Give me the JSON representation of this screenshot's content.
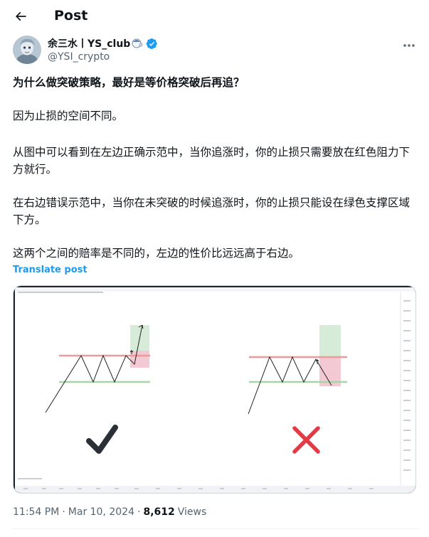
{
  "header": {
    "title": "Post",
    "back_icon": "arrow-left-icon"
  },
  "author": {
    "name": "余三水丨YS_club",
    "handle": "@YSI_crypto",
    "verified": true,
    "verified_color": "#1d9bf0",
    "more_icon": "more-horizontal-icon"
  },
  "tweet": {
    "p1": "为什么做突破策略，最好是等价格突破后再追？",
    "p2": "因为止损的空间不同。",
    "p3": "从图中可以看到在左边正确示范中，当你追涨时，你的止损只需要放在红色阻力下方就行。",
    "p4": "在右边错误示范中，当你在未突破的时候追涨时，你的止损只能设在绿色支撑区域下方。",
    "p5": "这两个之间的赔率是不同的，左边的性价比远远高于右边。",
    "translate_label": "Translate post",
    "translate_color": "#1d9bf0"
  },
  "media": {
    "left_mark": "checkmark-icon",
    "right_mark": "cross-icon",
    "resistance_color": "#ef9a9a",
    "support_color": "#a5d6a7",
    "cross_color": "#e53945"
  },
  "meta": {
    "time": "11:54 PM",
    "separator": "·",
    "date": "Mar 10, 2024",
    "views_count": "8,612",
    "views_label": "Views"
  }
}
